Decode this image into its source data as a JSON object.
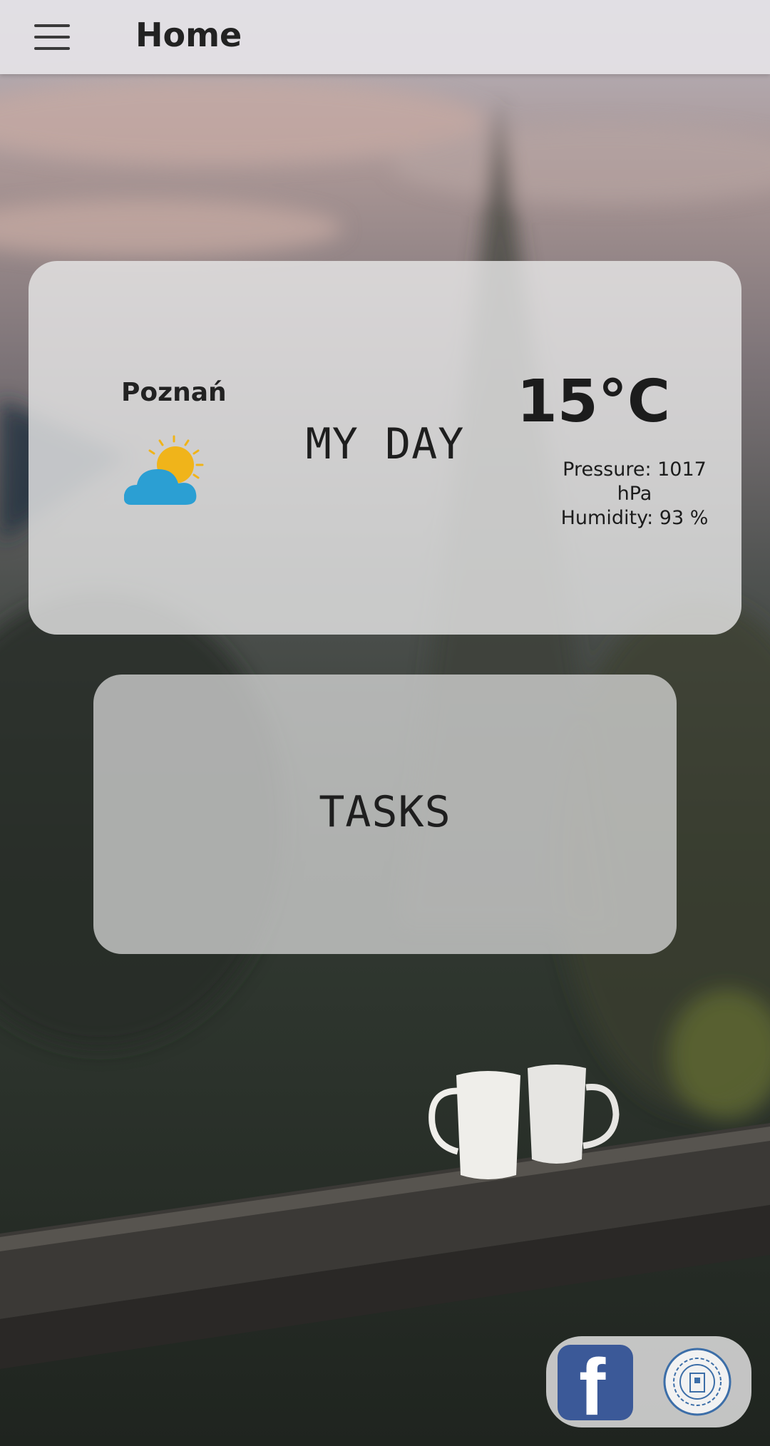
{
  "app_bar": {
    "title": "Home",
    "menu_icon": "hamburger-menu-icon"
  },
  "weather_card": {
    "city": "Poznań",
    "icon": "partly-cloudy-icon",
    "title": "MY DAY",
    "temperature": "15°C",
    "pressure": "Pressure: 1017 hPa",
    "humidity": "Humidity: 93 %"
  },
  "tasks_card": {
    "title": "TASKS"
  },
  "social": {
    "facebook_icon": "facebook-icon",
    "facebook_letter": "f",
    "university_logo": "university-logo-icon",
    "university_logo_text": "POLITECHNIKA POZNAŃSKA POZNAN UNIVERSITY OF TECHNOLOGY"
  },
  "colors": {
    "appbar_bg": "#e4e2e6",
    "card_bg": "#e8e8e8",
    "facebook_blue": "#3b5998",
    "cloud_blue": "#2b9fd3",
    "sun_yellow": "#f0b41a"
  }
}
